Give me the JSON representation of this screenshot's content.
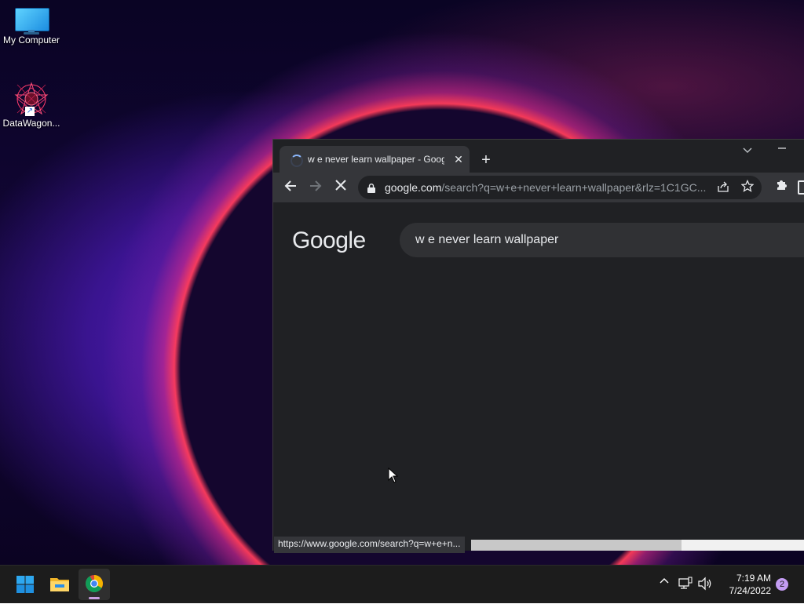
{
  "desktop": {
    "icons": [
      {
        "label": "My Computer"
      },
      {
        "label": "DataWagon..."
      }
    ]
  },
  "browser": {
    "tab": {
      "title": "w e never learn wallpaper - Goog"
    },
    "omnibox": {
      "url_host": "google.com",
      "url_path": "/search?q=w+e+never+learn+wallpaper&rlz=1C1GC..."
    },
    "page": {
      "logo": "Google",
      "search_query": "w e never learn wallpaper"
    },
    "status_bubble": "https://www.google.com/search?q=w+e+n...",
    "load_progress": 0.63
  },
  "taskbar": {
    "clock_time": "7:19 AM",
    "clock_date": "7/24/2022",
    "notification_count": "2"
  },
  "colors": {
    "chrome_bg": "#202124",
    "toolbar_bg": "#35363a",
    "spinner": "#8ab4f8",
    "taskbar_bg": "#1c1c1c",
    "badge": "#c39cf2"
  }
}
